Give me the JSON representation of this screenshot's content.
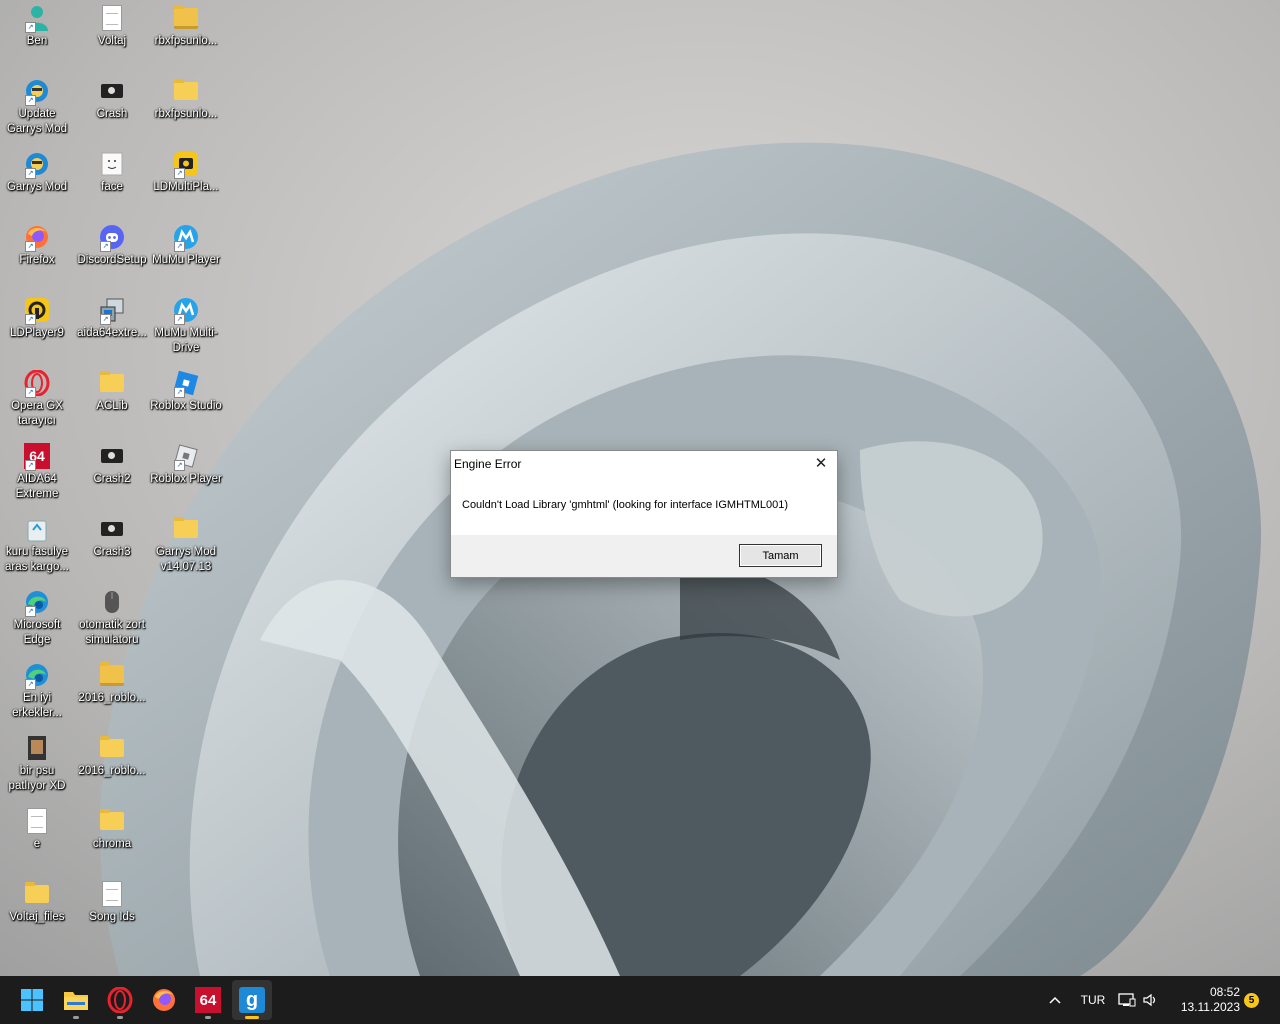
{
  "desktop": {
    "col1": [
      {
        "label": "Ben",
        "icon": "user-icon"
      },
      {
        "label": "Update Garrys Mod",
        "icon": "garrysmod-icon"
      },
      {
        "label": "Garrys Mod",
        "icon": "garrysmod-icon"
      },
      {
        "label": "Firefox",
        "icon": "firefox-icon"
      },
      {
        "label": "LDPlayer9",
        "icon": "ldplayer-icon"
      },
      {
        "label": "Opera GX tarayıcı",
        "icon": "opera-icon"
      },
      {
        "label": "AIDA64 Extreme",
        "icon": "aida64-icon"
      },
      {
        "label": "kuru fasulye aras kargo...",
        "icon": "recycle-icon"
      },
      {
        "label": "Microsoft Edge",
        "icon": "edge-icon"
      },
      {
        "label": "En iyi erkekler...",
        "icon": "edge-icon"
      },
      {
        "label": "bir psu patlıyor XD",
        "icon": "video-icon"
      },
      {
        "label": "e",
        "icon": "document-icon"
      },
      {
        "label": "Voltaj_files",
        "icon": "folder-icon"
      }
    ],
    "col2": [
      {
        "label": "Voltaj",
        "icon": "document-icon"
      },
      {
        "label": "Crash",
        "icon": "camera-icon"
      },
      {
        "label": "face",
        "icon": "face-icon"
      },
      {
        "label": "DiscordSetup",
        "icon": "discord-icon"
      },
      {
        "label": "aida64extre...",
        "icon": "installer-icon"
      },
      {
        "label": "ACLib",
        "icon": "folder-icon"
      },
      {
        "label": "Crash2",
        "icon": "camera-icon"
      },
      {
        "label": "Crash3",
        "icon": "camera-icon"
      },
      {
        "label": "otomatik zort simulatoru",
        "icon": "mouse-icon"
      },
      {
        "label": "2016_roblo...",
        "icon": "zip-folder-icon"
      },
      {
        "label": "2016_roblo...",
        "icon": "folder-icon"
      },
      {
        "label": "chroma",
        "icon": "folder-icon"
      },
      {
        "label": "Song Ids",
        "icon": "document-icon"
      }
    ],
    "col3": [
      {
        "label": "rbxfpsunlo...",
        "icon": "zip-folder-icon"
      },
      {
        "label": "rbxfpsunlo...",
        "icon": "folder-icon"
      },
      {
        "label": "LDMultiPla...",
        "icon": "ldmultiplayer-icon"
      },
      {
        "label": "MuMu Player",
        "icon": "mumu-icon"
      },
      {
        "label": "MuMu Multi-Drive",
        "icon": "mumu-icon"
      },
      {
        "label": "Roblox Studio",
        "icon": "roblox-studio-icon"
      },
      {
        "label": "Roblox Player",
        "icon": "roblox-icon"
      },
      {
        "label": "Garrys Mod v14.07.13",
        "icon": "folder-icon"
      }
    ]
  },
  "dialog": {
    "title": "Engine Error",
    "message": "Couldn't Load Library 'gmhtml' (looking for interface IGMHTML001)",
    "ok_label": "Tamam",
    "close_glyph": "✕"
  },
  "taskbar": {
    "apps": [
      {
        "name": "start-button"
      },
      {
        "name": "file-explorer"
      },
      {
        "name": "opera-gx"
      },
      {
        "name": "firefox"
      },
      {
        "name": "aida64",
        "text": "64"
      },
      {
        "name": "garrys-mod",
        "text": "g"
      }
    ],
    "language": "TUR",
    "time": "08:52",
    "date": "13.11.2023",
    "notification_count": "5",
    "chevron": "^"
  },
  "colors": {
    "accent": "#4cc2ff",
    "taskbar": "#1c1c1c",
    "notification": "#f9c51b"
  }
}
